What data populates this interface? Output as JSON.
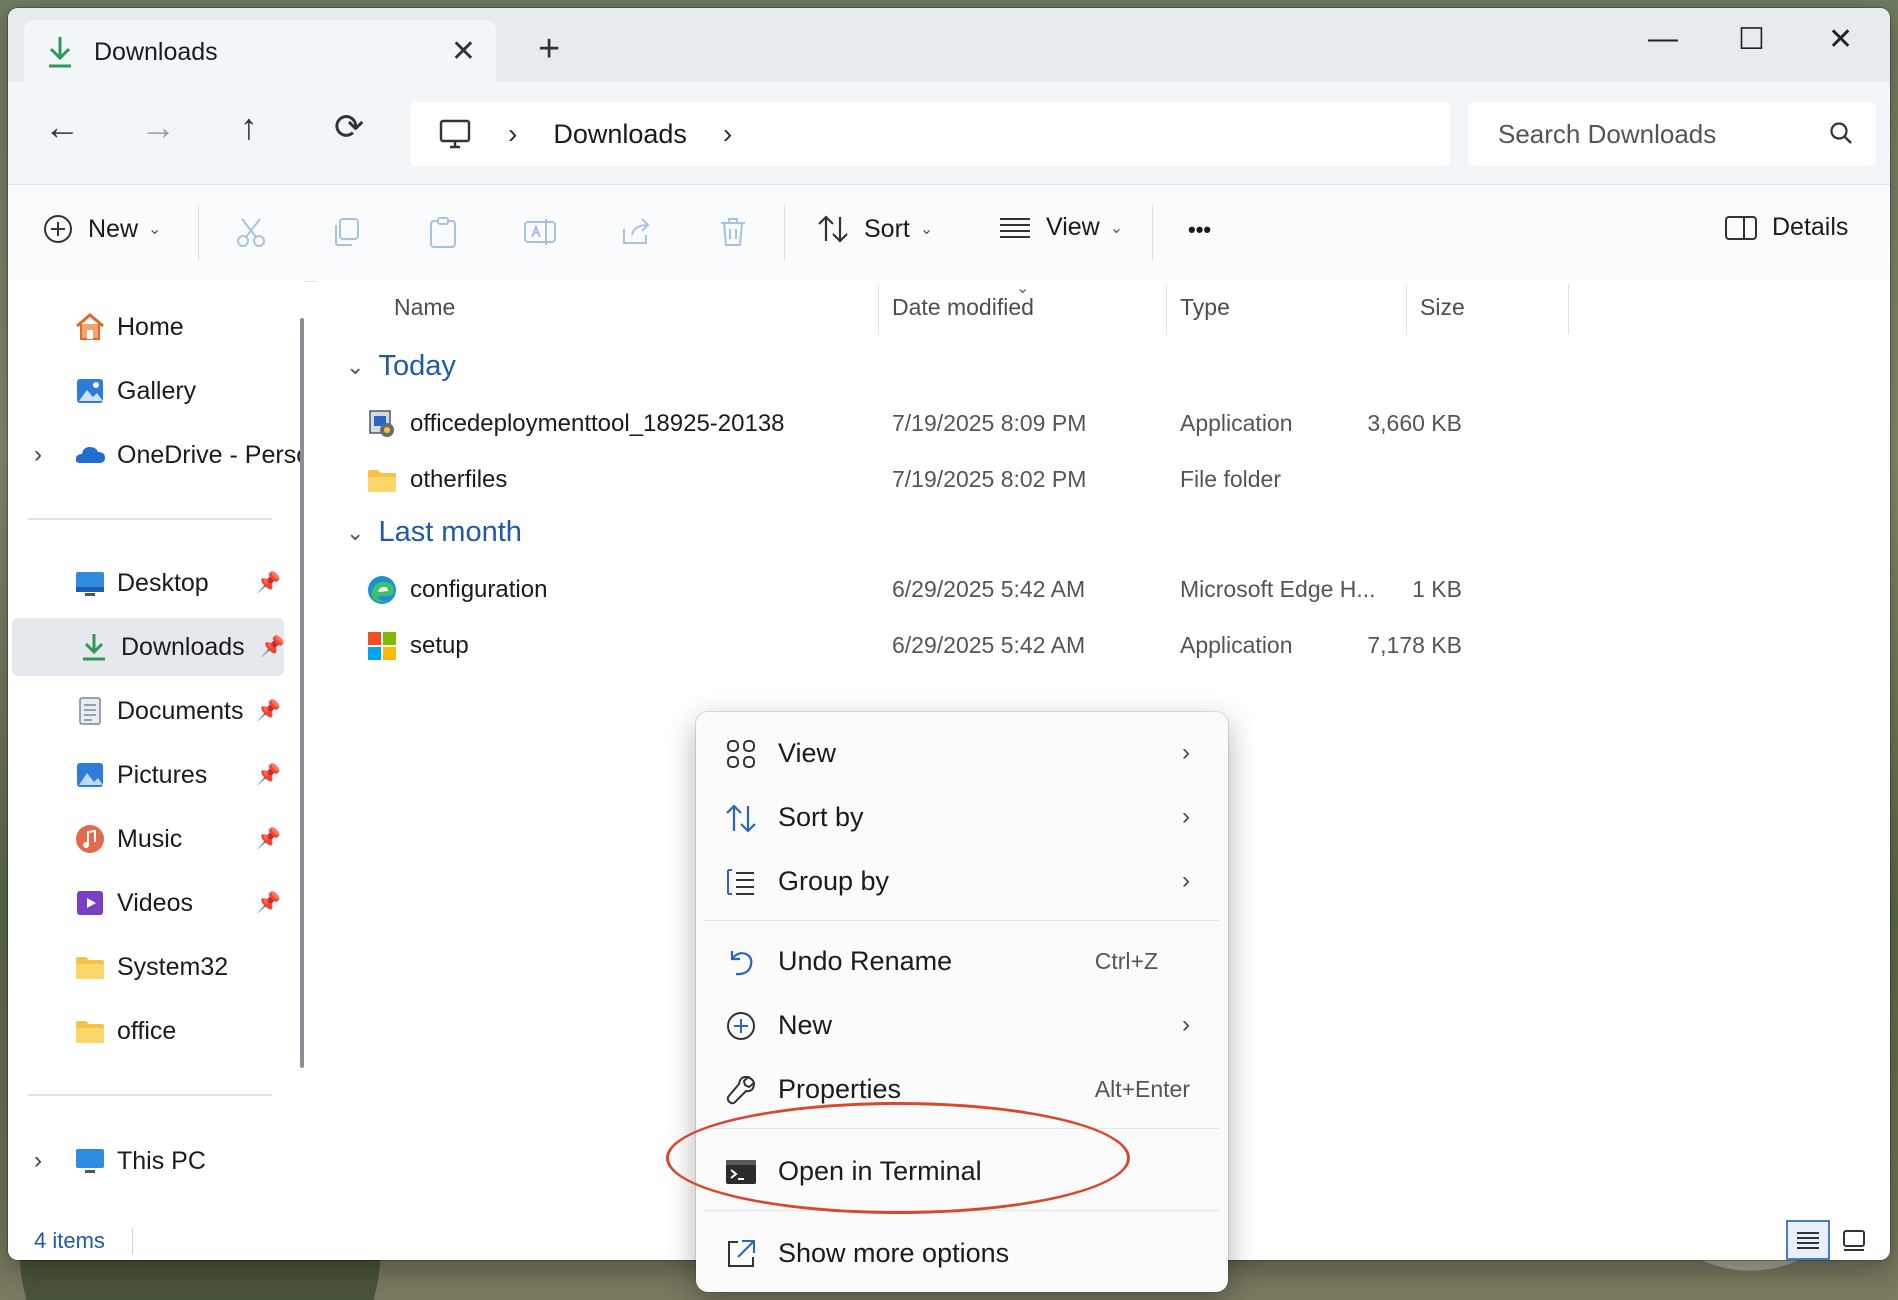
{
  "window": {
    "tab_title": "Downloads",
    "tab_close": "✕",
    "new_tab": "+",
    "minimize": "—",
    "maximize": "☐",
    "close": "✕"
  },
  "nav": {
    "back": "←",
    "forward": "→",
    "up": "↑",
    "refresh": "⟳",
    "breadcrumb_sep": "›",
    "breadcrumb": [
      "Downloads"
    ],
    "search_placeholder": "Search Downloads"
  },
  "toolbar": {
    "new_label": "New",
    "sort_label": "Sort",
    "view_label": "View",
    "more_label": "•••",
    "details_label": "Details"
  },
  "sidebar": {
    "items": [
      {
        "label": "Home",
        "icon": "home-icon"
      },
      {
        "label": "Gallery",
        "icon": "gallery-icon"
      },
      {
        "label": "OneDrive - Perso",
        "icon": "onedrive-icon",
        "expandable": true
      },
      {
        "label": "Desktop",
        "icon": "desktop-icon",
        "pinned": true
      },
      {
        "label": "Downloads",
        "icon": "downloads-icon",
        "pinned": true,
        "selected": true
      },
      {
        "label": "Documents",
        "icon": "documents-icon",
        "pinned": true
      },
      {
        "label": "Pictures",
        "icon": "pictures-icon",
        "pinned": true
      },
      {
        "label": "Music",
        "icon": "music-icon",
        "pinned": true
      },
      {
        "label": "Videos",
        "icon": "videos-icon",
        "pinned": true
      },
      {
        "label": "System32",
        "icon": "folder-icon"
      },
      {
        "label": "office",
        "icon": "folder-icon"
      },
      {
        "label": "This PC",
        "icon": "this-pc-icon",
        "expandable": true
      }
    ]
  },
  "columns": {
    "name": "Name",
    "date": "Date modified",
    "type": "Type",
    "size": "Size"
  },
  "groups": [
    {
      "label": "Today",
      "files": [
        {
          "name": "officedeploymenttool_18925-20138",
          "date": "7/19/2025 8:09 PM",
          "type": "Application",
          "size": "3,660 KB",
          "icon": "installer-icon"
        },
        {
          "name": "otherfiles",
          "date": "7/19/2025 8:02 PM",
          "type": "File folder",
          "size": "",
          "icon": "folder-icon"
        }
      ]
    },
    {
      "label": "Last month",
      "files": [
        {
          "name": "configuration",
          "date": "6/29/2025 5:42 AM",
          "type": "Microsoft Edge H...",
          "size": "1 KB",
          "icon": "edge-icon"
        },
        {
          "name": "setup",
          "date": "6/29/2025 5:42 AM",
          "type": "Application",
          "size": "7,178 KB",
          "icon": "windows-logo-icon"
        }
      ]
    }
  ],
  "status": {
    "item_count": "4 items"
  },
  "context_menu": {
    "items": [
      {
        "label": "View",
        "icon": "view-grid-icon",
        "submenu": true
      },
      {
        "label": "Sort by",
        "icon": "sort-icon",
        "submenu": true
      },
      {
        "label": "Group by",
        "icon": "group-by-icon",
        "submenu": true
      },
      {
        "label": "Undo Rename",
        "icon": "undo-icon",
        "shortcut": "Ctrl+Z"
      },
      {
        "label": "New",
        "icon": "new-plus-icon",
        "submenu": true
      },
      {
        "label": "Properties",
        "icon": "wrench-icon",
        "shortcut": "Alt+Enter"
      },
      {
        "label": "Open in Terminal",
        "icon": "terminal-icon"
      },
      {
        "label": "Show more options",
        "icon": "more-options-icon"
      }
    ],
    "submenu_arrow": "›"
  },
  "colors": {
    "accent": "#1f5aa6",
    "annotation": "#d9472e"
  }
}
